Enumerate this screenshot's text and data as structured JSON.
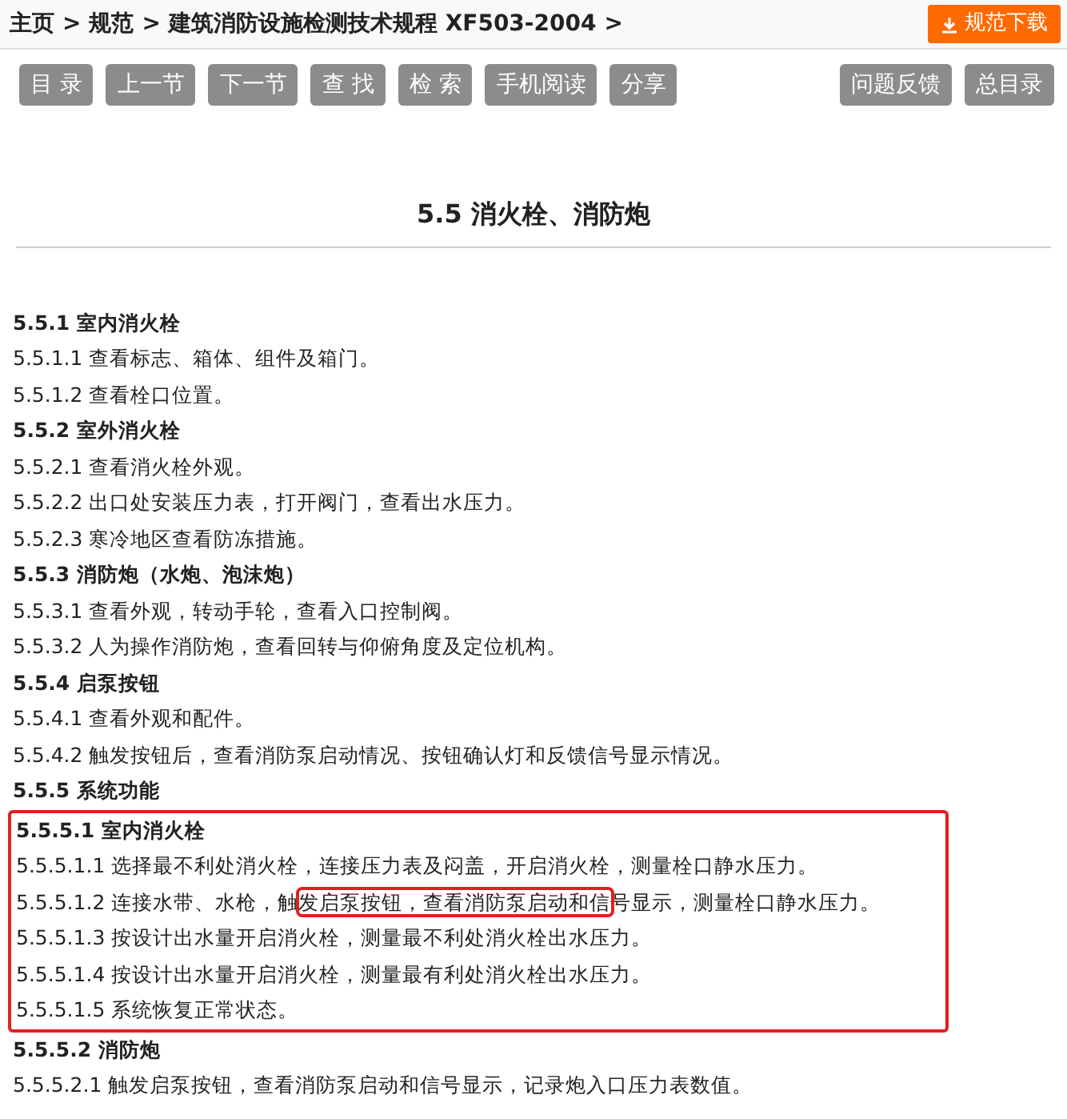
{
  "breadcrumb": [
    "主页",
    ">",
    "规范",
    ">",
    "建筑消防设施检测技术规程 XF503-2004",
    ">"
  ],
  "download_button": "规范下载",
  "toolbar_left": [
    "目 录",
    "上一节",
    "下一节",
    "查 找",
    "检 索",
    "手机阅读",
    "分享"
  ],
  "toolbar_right": [
    "问题反馈",
    "总目录"
  ],
  "section_title": "5.5 消火栓、消防炮",
  "lines": [
    {
      "kind": "heading",
      "text": "5.5.1 室内消火栓"
    },
    {
      "kind": "item",
      "text": "5.5.1.1 查看标志、箱体、组件及箱门。"
    },
    {
      "kind": "item",
      "text": "5.5.1.2 查看栓口位置。"
    },
    {
      "kind": "heading",
      "text": "5.5.2 室外消火栓"
    },
    {
      "kind": "item",
      "text": "5.5.2.1 查看消火栓外观。"
    },
    {
      "kind": "item",
      "text": "5.5.2.2 出口处安装压力表，打开阀门，查看出水压力。"
    },
    {
      "kind": "item",
      "text": "5.5.2.3 寒冷地区查看防冻措施。"
    },
    {
      "kind": "heading",
      "text": "5.5.3 消防炮（水炮、泡沫炮）"
    },
    {
      "kind": "item",
      "text": "5.5.3.1 查看外观，转动手轮，查看入口控制阀。"
    },
    {
      "kind": "item",
      "text": "5.5.3.2 人为操作消防炮，查看回转与仰俯角度及定位机构。"
    },
    {
      "kind": "heading",
      "text": "5.5.4 启泵按钮"
    },
    {
      "kind": "item",
      "text": "5.5.4.1 查看外观和配件。"
    },
    {
      "kind": "item",
      "text": "5.5.4.2 触发按钮后，查看消防泵启动情况、按钮确认灯和反馈信号显示情况。"
    },
    {
      "kind": "heading",
      "text": "5.5.5 系统功能"
    },
    {
      "kind": "boxed_group",
      "lines": [
        {
          "kind": "heading",
          "text": "5.5.5.1 室内消火栓"
        },
        {
          "kind": "item",
          "text": "5.5.5.1.1 选择最不利处消火栓，连接压力表及闷盖，开启消火栓，测量栓口静水压力。"
        },
        {
          "kind": "item",
          "parts": [
            {
              "text": "5.5.5.1.2 连接水带、水枪，触",
              "highlighted": false
            },
            {
              "text": "发启泵按钮，查看消防泵启动和信",
              "highlighted": true
            },
            {
              "text": "号显示，测量栓口静水压力。",
              "highlighted": false
            }
          ]
        },
        {
          "kind": "item",
          "text": "5.5.5.1.3 按设计出水量开启消火栓，测量最不利处消火栓出水压力。"
        },
        {
          "kind": "item",
          "text": "5.5.5.1.4 按设计出水量开启消火栓，测量最有利处消火栓出水压力。"
        },
        {
          "kind": "item",
          "text": "5.5.5.1.5 系统恢复正常状态。"
        }
      ]
    },
    {
      "kind": "heading",
      "text": "5.5.5.2 消防炮"
    },
    {
      "kind": "item",
      "text": "5.5.5.2.1 触发启泵按钮，查看消防泵启动和信号显示，记录炮入口压力表数值。"
    }
  ]
}
